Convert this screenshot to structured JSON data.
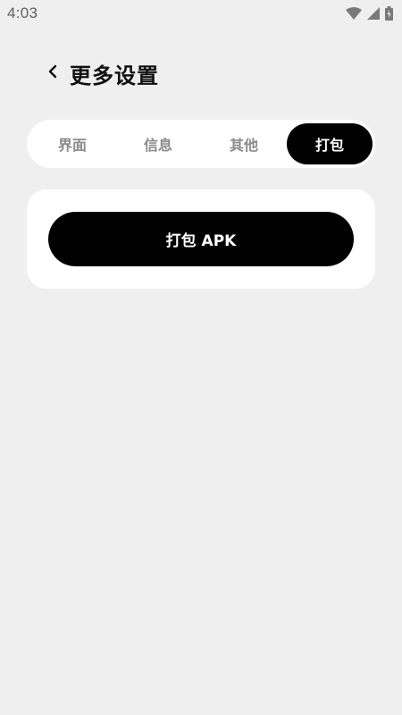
{
  "status_bar": {
    "time": "4:03",
    "icons": [
      "wifi-icon",
      "cell-signal-icon",
      "battery-icon"
    ]
  },
  "header": {
    "back_icon": "chevron-left-icon",
    "title": "更多设置"
  },
  "tabs": [
    {
      "label": "界面",
      "active": false
    },
    {
      "label": "信息",
      "active": false
    },
    {
      "label": "其他",
      "active": false
    },
    {
      "label": "打包",
      "active": true
    }
  ],
  "card": {
    "button_label": "打包 APK"
  },
  "colors": {
    "background": "#efefef",
    "surface": "#ffffff",
    "accent": "#000000",
    "inactive_text": "#8a8a8a"
  }
}
